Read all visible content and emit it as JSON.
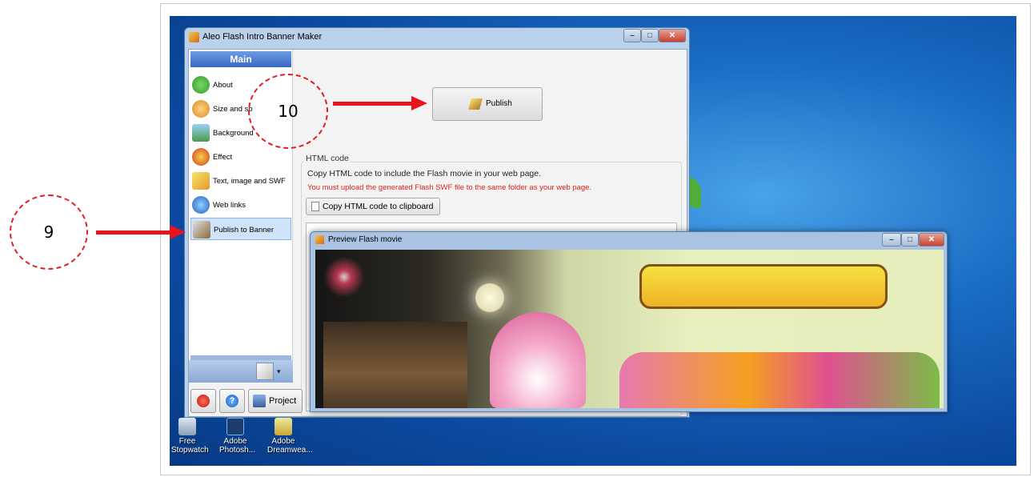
{
  "desktop": {
    "icons": [
      {
        "label": "Free Stopwatch"
      },
      {
        "label": "Adobe Photosh..."
      },
      {
        "label": "Adobe Dreamwea..."
      }
    ]
  },
  "main_window": {
    "title": "Aleo Flash Intro Banner Maker",
    "sidebar": {
      "header": "Main",
      "items": [
        {
          "label": "About"
        },
        {
          "label": "Size and so"
        },
        {
          "label": "Background"
        },
        {
          "label": "Effect"
        },
        {
          "label": "Text, image and SWF"
        },
        {
          "label": "Web links"
        },
        {
          "label": "Publish to Banner"
        }
      ]
    },
    "publish_label": "Publish",
    "html_group": {
      "title": "HTML code",
      "description": "Copy HTML code to include the Flash movie in your web page.",
      "warning": "You must upload the generated Flash SWF file to the same folder as your web page.",
      "copy_button": "Copy HTML code to clipboard"
    },
    "project_label": "Project"
  },
  "preview_window": {
    "title": "Preview Flash movie"
  },
  "annotations": {
    "step9": "9",
    "step10": "10"
  },
  "colors": {
    "annotation_red": "#e8141c",
    "warning_red": "#e02020",
    "sidebar_header": "#3768c5"
  }
}
